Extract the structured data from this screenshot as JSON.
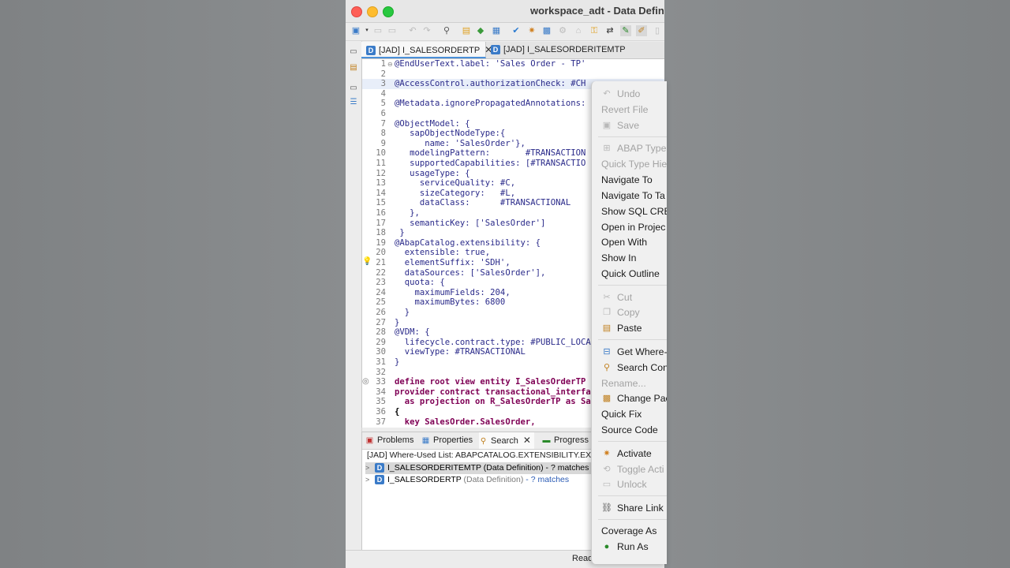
{
  "window": {
    "title": "workspace_adt - Data Definiti"
  },
  "editor_tabs": [
    {
      "label": "[JAD] I_SALESORDERTP",
      "close": "✕"
    },
    {
      "label": "[JAD] I_SALESORDERITEMTP"
    }
  ],
  "code_lines": [
    {
      "n": "1",
      "t": "@EndUserText.label: 'Sales Order - TP'"
    },
    {
      "n": "2",
      "t": ""
    },
    {
      "n": "3",
      "t": "@AccessControl.authorizationCheck: #CH"
    },
    {
      "n": "4",
      "t": ""
    },
    {
      "n": "5",
      "t": "@Metadata.ignorePropagatedAnnotations:"
    },
    {
      "n": "6",
      "t": ""
    },
    {
      "n": "7",
      "t": "@ObjectModel: {"
    },
    {
      "n": "8",
      "t": "   sapObjectNodeType:{"
    },
    {
      "n": "9",
      "t": "      name: 'SalesOrder'},"
    },
    {
      "n": "10",
      "t": "   modelingPattern:       #TRANSACTION"
    },
    {
      "n": "11",
      "t": "   supportedCapabilities: [#TRANSACTIO"
    },
    {
      "n": "12",
      "t": "   usageType: {"
    },
    {
      "n": "13",
      "t": "     serviceQuality: #C,"
    },
    {
      "n": "14",
      "t": "     sizeCategory:   #L,"
    },
    {
      "n": "15",
      "t": "     dataClass:      #TRANSACTIONAL"
    },
    {
      "n": "16",
      "t": "   },"
    },
    {
      "n": "17",
      "t": "   semanticKey: ['SalesOrder']"
    },
    {
      "n": "18",
      "t": " }"
    },
    {
      "n": "19",
      "t": "@AbapCatalog.extensibility: {"
    },
    {
      "n": "20",
      "t": "  extensible: true,"
    },
    {
      "n": "21",
      "t": "  elementSuffix: 'SDH',"
    },
    {
      "n": "22",
      "t": "  dataSources: ['SalesOrder'],"
    },
    {
      "n": "23",
      "t": "  quota: {"
    },
    {
      "n": "24",
      "t": "    maximumFields: 204,"
    },
    {
      "n": "25",
      "t": "    maximumBytes: 6800"
    },
    {
      "n": "26",
      "t": "  }"
    },
    {
      "n": "27",
      "t": "}"
    },
    {
      "n": "28",
      "t": "@VDM: {"
    },
    {
      "n": "29",
      "t": "  lifecycle.contract.type: #PUBLIC_LOCA"
    },
    {
      "n": "30",
      "t": "  viewType: #TRANSACTIONAL"
    },
    {
      "n": "31",
      "t": "}"
    },
    {
      "n": "32",
      "t": ""
    },
    {
      "n": "33",
      "t": "define root view entity I_SalesOrderTP"
    },
    {
      "n": "34",
      "t": "provider contract transactional_interfa"
    },
    {
      "n": "35",
      "t": "  as projection on R_SalesOrderTP as Sa"
    },
    {
      "n": "36",
      "t": "{"
    },
    {
      "n": "37",
      "t": "  key SalesOrder.SalesOrder,"
    }
  ],
  "panel": {
    "tabs": [
      "Problems",
      "Properties",
      "Search",
      "Progress"
    ],
    "search_close": "✕",
    "search_header": "[JAD] Where-Used List: ABAPCATALOG.EXTENSIBILITY.EXTE",
    "results": [
      {
        "name": "I_SALESORDERITEMTP",
        "type": " (Data Definition)",
        "matches": " - ? matches"
      },
      {
        "name": "I_SALESORDERTP",
        "type": " (Data Definition)",
        "matches": " - ? matches"
      }
    ]
  },
  "status": "Read",
  "context_menu": {
    "items": [
      {
        "label": "Undo",
        "disabled": true,
        "icon": "undo-icon"
      },
      {
        "label": "Revert File",
        "disabled": true
      },
      {
        "label": "Save",
        "disabled": true,
        "icon": "save-icon"
      },
      {
        "sep": true
      },
      {
        "label": "ABAP Type",
        "disabled": true,
        "icon": "type-hierarchy-icon"
      },
      {
        "label": "Quick Type Hie",
        "disabled": true
      },
      {
        "label": "Navigate To"
      },
      {
        "label": "Navigate To Ta"
      },
      {
        "label": "Show SQL CRE"
      },
      {
        "label": "Open in Projec"
      },
      {
        "label": "Open With"
      },
      {
        "label": "Show In"
      },
      {
        "label": "Quick Outline"
      },
      {
        "sep": true
      },
      {
        "label": "Cut",
        "disabled": true,
        "icon": "cut-icon"
      },
      {
        "label": "Copy",
        "disabled": true,
        "icon": "copy-icon"
      },
      {
        "label": "Paste",
        "icon": "paste-icon"
      },
      {
        "sep": true
      },
      {
        "label": "Get Where-",
        "icon": "where-used-icon"
      },
      {
        "label": "Search Con",
        "icon": "search-icon"
      },
      {
        "label": "Rename...",
        "disabled": true
      },
      {
        "label": "Change Pac",
        "icon": "package-icon"
      },
      {
        "label": "Quick Fix"
      },
      {
        "label": "Source Code"
      },
      {
        "sep": true
      },
      {
        "label": "Activate",
        "icon": "activate-icon"
      },
      {
        "label": "Toggle Acti",
        "disabled": true,
        "icon": "toggle-icon"
      },
      {
        "label": "Unlock",
        "disabled": true,
        "icon": "lock-icon"
      },
      {
        "sep": true
      },
      {
        "label": "Share Link",
        "icon": "share-icon"
      },
      {
        "sep": true
      },
      {
        "label": "Coverage As"
      },
      {
        "label": "Run As",
        "icon": "run-icon"
      }
    ]
  }
}
